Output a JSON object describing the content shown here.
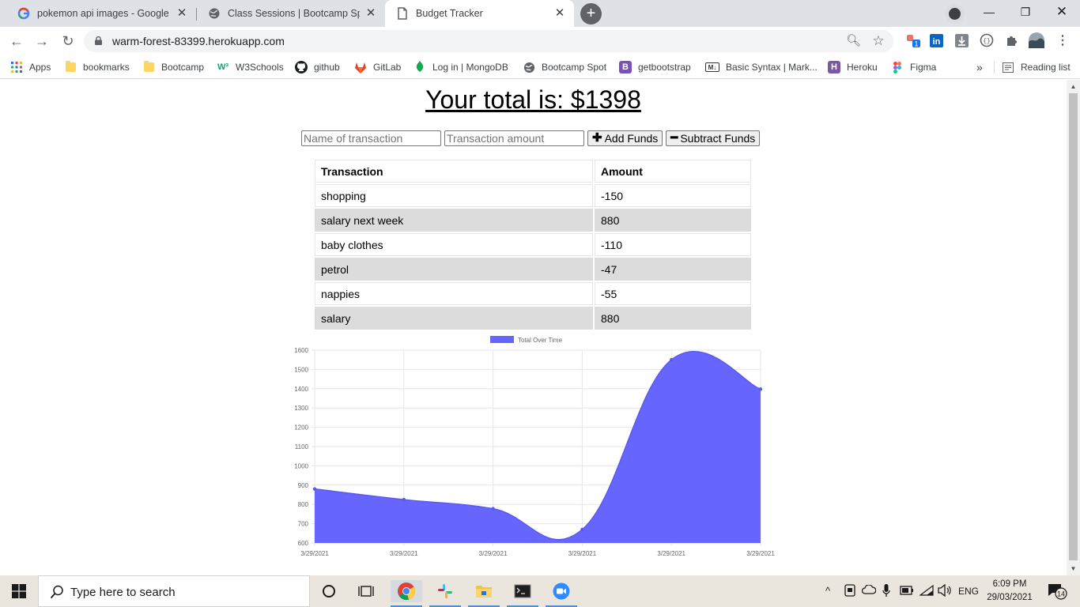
{
  "browser": {
    "tabs": [
      {
        "title": "pokemon api images - Google Se",
        "icon": "google-icon"
      },
      {
        "title": "Class Sessions | Bootcamp Spot",
        "icon": "globe-icon"
      },
      {
        "title": "Budget Tracker",
        "icon": "page-icon",
        "active": true
      }
    ],
    "url": "warm-forest-83399.herokuapp.com",
    "extension_badge": "1",
    "bookmarks": [
      {
        "label": "Apps",
        "icon": "apps-grid-icon"
      },
      {
        "label": "bookmarks",
        "icon": "folder-icon"
      },
      {
        "label": "Bootcamp",
        "icon": "folder-icon"
      },
      {
        "label": "W3Schools",
        "icon": "w3schools-icon",
        "glyph": "W³"
      },
      {
        "label": "github",
        "icon": "github-icon"
      },
      {
        "label": "GitLab",
        "icon": "gitlab-icon"
      },
      {
        "label": "Log in | MongoDB",
        "icon": "mongodb-icon"
      },
      {
        "label": "Bootcamp Spot",
        "icon": "globe-icon"
      },
      {
        "label": "getbootstrap",
        "icon": "bootstrap-icon",
        "glyph": "B"
      },
      {
        "label": "Basic Syntax | Mark...",
        "icon": "markdown-icon",
        "glyph": "M↓"
      },
      {
        "label": "Heroku",
        "icon": "heroku-icon",
        "glyph": "H"
      },
      {
        "label": "Figma",
        "icon": "figma-icon"
      }
    ],
    "more_bookmarks": "»",
    "reading_list": "Reading list"
  },
  "app": {
    "total_text": "Your total is: $1398",
    "name_placeholder": "Name of transaction",
    "amount_placeholder": "Transaction amount",
    "add_label": "Add Funds",
    "subtract_label": "Subtract Funds",
    "table": {
      "headers": [
        "Transaction",
        "Amount"
      ],
      "rows": [
        {
          "name": "shopping",
          "amount": "-150"
        },
        {
          "name": "salary next week",
          "amount": "880"
        },
        {
          "name": "baby clothes",
          "amount": "-110"
        },
        {
          "name": "petrol",
          "amount": "-47"
        },
        {
          "name": "nappies",
          "amount": "-55"
        },
        {
          "name": "salary",
          "amount": "880"
        }
      ]
    }
  },
  "chart_data": {
    "type": "area",
    "categories": [
      "3/29/2021",
      "3/29/2021",
      "3/29/2021",
      "3/29/2021",
      "3/29/2021",
      "3/29/2021"
    ],
    "series": [
      {
        "name": "Total Over Time",
        "values": [
          880,
          825,
          778,
          670,
          1550,
          1398
        ]
      }
    ],
    "ylim": [
      600,
      1600
    ],
    "yticks": [
      600,
      700,
      800,
      900,
      1000,
      1100,
      1200,
      1300,
      1400,
      1500,
      1600
    ],
    "grid": true,
    "legend": "top-center",
    "fill_color": "#6666ff"
  },
  "taskbar": {
    "search_placeholder": "Type here to search",
    "language": "ENG",
    "time": "6:09 PM",
    "date": "29/03/2021",
    "notifications": "14"
  }
}
